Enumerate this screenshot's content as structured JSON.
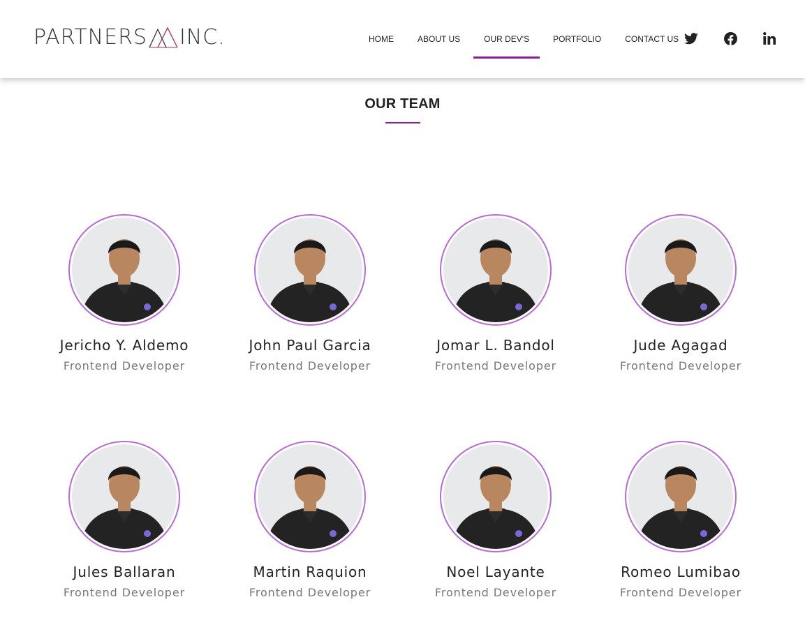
{
  "logo": {
    "left": "PARTNERS",
    "right": "INC."
  },
  "nav": {
    "items": [
      {
        "label": "HOME"
      },
      {
        "label": "ABOUT US"
      },
      {
        "label": "OUR DEV'S"
      },
      {
        "label": "PORTFOLIO"
      },
      {
        "label": "CONTACT US"
      }
    ],
    "active": "OUR DEV'S"
  },
  "social": [
    "twitter-icon",
    "facebook-icon",
    "linkedin-icon"
  ],
  "section": {
    "title": "OUR TEAM"
  },
  "team": [
    {
      "name": "Jericho Y. Aldemo",
      "role": "Frontend Developer"
    },
    {
      "name": "John Paul Garcia",
      "role": "Frontend Developer"
    },
    {
      "name": "Jomar L. Bandol",
      "role": "Frontend Developer"
    },
    {
      "name": "Jude Agagad",
      "role": "Frontend Developer"
    },
    {
      "name": "Jules Ballaran",
      "role": "Frontend Developer"
    },
    {
      "name": "Martin Raquion",
      "role": "Frontend Developer"
    },
    {
      "name": "Noel Layante",
      "role": "Frontend Developer"
    },
    {
      "name": "Romeo Lumibao",
      "role": "Frontend Developer"
    }
  ],
  "colors": {
    "accent": "#8e1b9c",
    "ring": "#b76ad8",
    "shirt": "#232323",
    "skin": "#b8875f",
    "hair": "#1a1a1a"
  }
}
